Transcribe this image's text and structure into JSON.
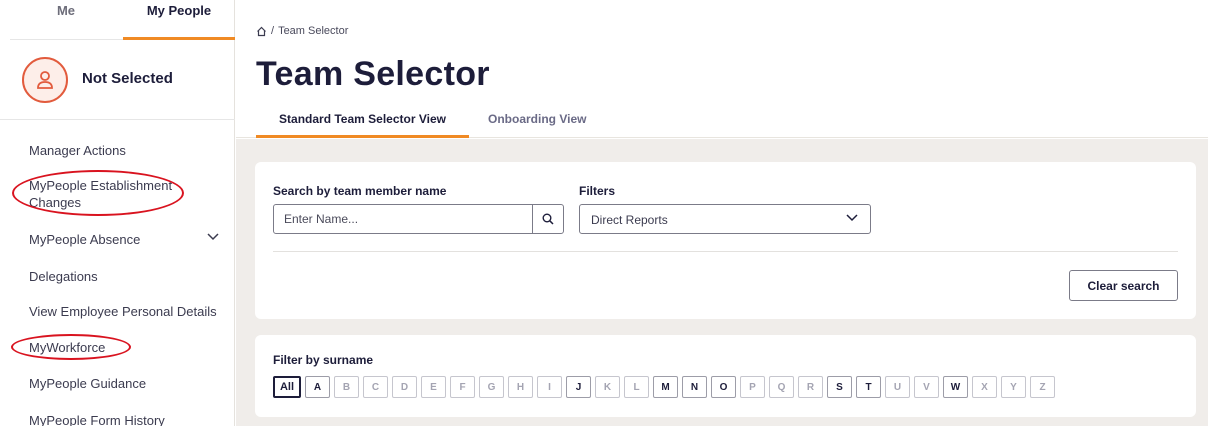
{
  "sidebar": {
    "tabs": [
      {
        "label": "Me"
      },
      {
        "label": "My People"
      }
    ],
    "profile_name": "Not Selected",
    "items": [
      {
        "label": "Manager Actions"
      },
      {
        "label": "MyPeople Establishment Changes"
      },
      {
        "label": "MyPeople Absence"
      },
      {
        "label": "Delegations"
      },
      {
        "label": "View Employee Personal Details"
      },
      {
        "label": "MyWorkforce"
      },
      {
        "label": "MyPeople Guidance"
      },
      {
        "label": "MyPeople Form History"
      }
    ]
  },
  "breadcrumb": {
    "separator": "/",
    "current": "Team Selector"
  },
  "page_title": "Team Selector",
  "view_tabs": [
    {
      "label": "Standard Team Selector View"
    },
    {
      "label": "Onboarding View"
    }
  ],
  "search": {
    "label": "Search by team member name",
    "placeholder": "Enter Name...",
    "filters_label": "Filters",
    "filter_value": "Direct Reports",
    "clear_label": "Clear search"
  },
  "surname_filter": {
    "label": "Filter by surname",
    "letters": [
      {
        "l": "All",
        "state": "selected"
      },
      {
        "l": "A",
        "state": "on"
      },
      {
        "l": "B",
        "state": "off"
      },
      {
        "l": "C",
        "state": "off"
      },
      {
        "l": "D",
        "state": "off"
      },
      {
        "l": "E",
        "state": "off"
      },
      {
        "l": "F",
        "state": "off"
      },
      {
        "l": "G",
        "state": "off"
      },
      {
        "l": "H",
        "state": "off"
      },
      {
        "l": "I",
        "state": "off"
      },
      {
        "l": "J",
        "state": "on"
      },
      {
        "l": "K",
        "state": "off"
      },
      {
        "l": "L",
        "state": "off"
      },
      {
        "l": "M",
        "state": "on"
      },
      {
        "l": "N",
        "state": "on"
      },
      {
        "l": "O",
        "state": "on"
      },
      {
        "l": "P",
        "state": "off"
      },
      {
        "l": "Q",
        "state": "off"
      },
      {
        "l": "R",
        "state": "off"
      },
      {
        "l": "S",
        "state": "on"
      },
      {
        "l": "T",
        "state": "on"
      },
      {
        "l": "U",
        "state": "off"
      },
      {
        "l": "V",
        "state": "off"
      },
      {
        "l": "W",
        "state": "on"
      },
      {
        "l": "X",
        "state": "off"
      },
      {
        "l": "Y",
        "state": "off"
      },
      {
        "l": "Z",
        "state": "off"
      }
    ]
  },
  "colors": {
    "accent": "#f08a24",
    "annotation": "#d9131f",
    "avatar": "#e25b3d",
    "text": "#1d1d3a",
    "background": "#f0edea"
  }
}
